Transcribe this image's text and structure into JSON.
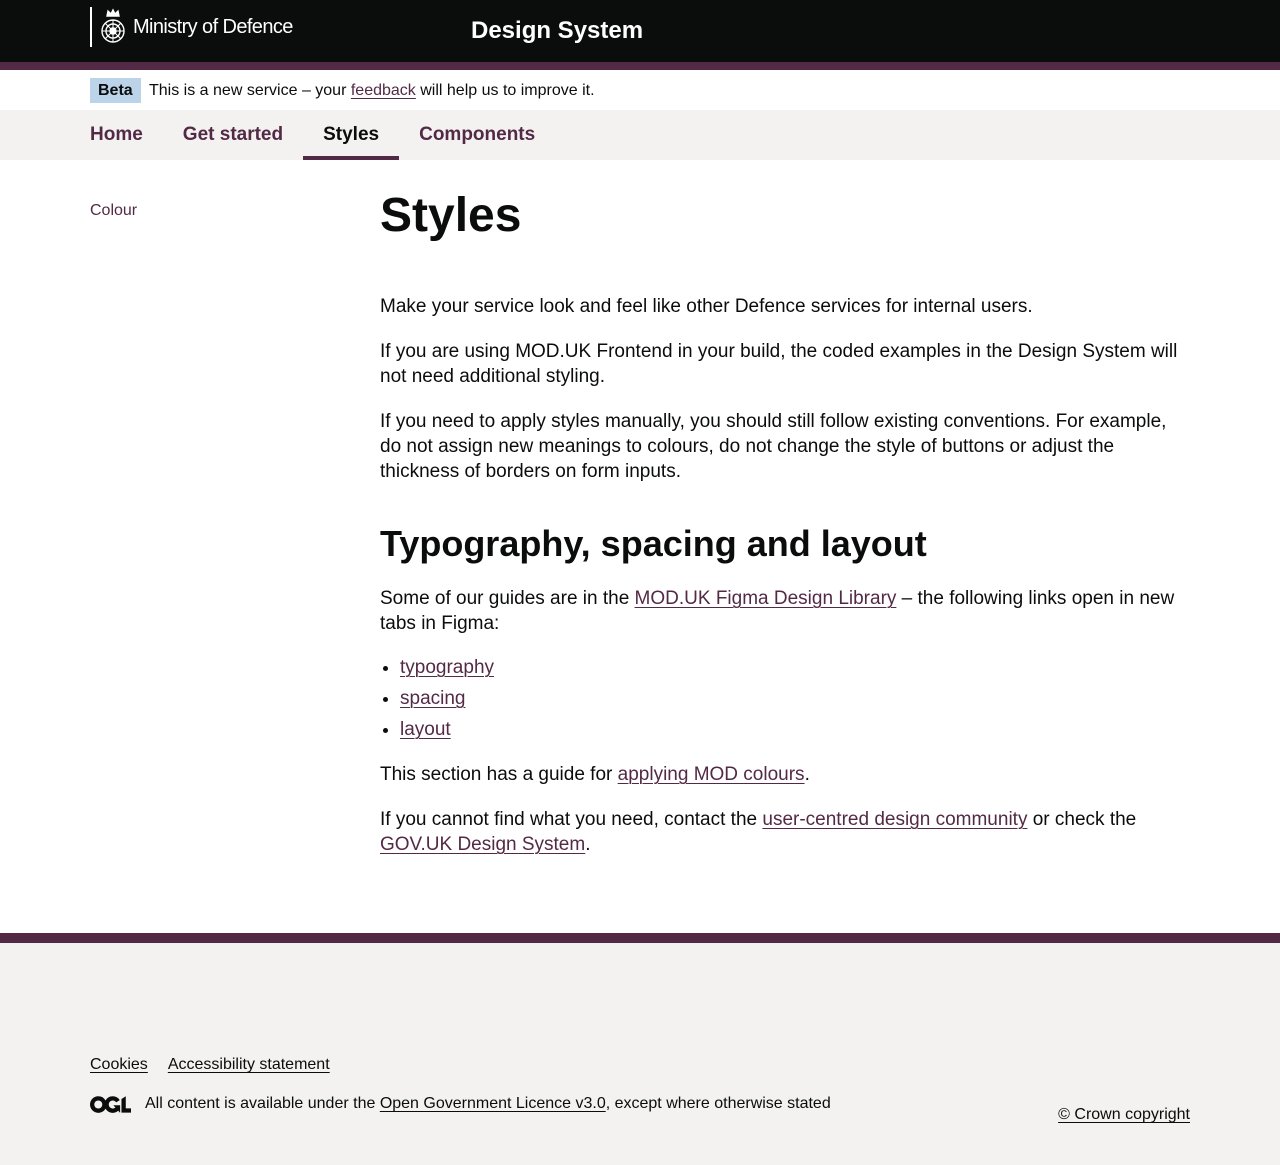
{
  "header": {
    "logo_text": "Ministry of Defence",
    "service_name": "Design System"
  },
  "phase_banner": {
    "tag": "Beta",
    "text_before": "This is a new service – your ",
    "link": "feedback",
    "text_after": " will help us to improve it."
  },
  "nav": {
    "items": [
      {
        "label": "Home"
      },
      {
        "label": "Get started"
      },
      {
        "label": "Styles",
        "active": true
      },
      {
        "label": "Components"
      }
    ]
  },
  "side_nav": {
    "items": [
      {
        "label": "Colour"
      }
    ]
  },
  "content": {
    "title": "Styles",
    "intro_1": "Make your service look and feel like other Defence services for internal users.",
    "intro_2": "If you are using MOD.UK Frontend in your build, the coded examples in the Design System will not need additional styling.",
    "intro_3": "If you need to apply styles manually, you should still follow existing conventions. For example, do not assign new meanings to colours, do not change the style of buttons or adjust the thickness of borders on form inputs.",
    "section_heading": "Typography, spacing and layout",
    "guides_before": "Some of our guides are in the ",
    "guides_link": "MOD.UK Figma Design Library",
    "guides_after": " – the following links open in new tabs in Figma:",
    "guide_links": [
      "typography",
      "spacing",
      "layout"
    ],
    "colour_before": "This section has a guide for ",
    "colour_link": "applying MOD colours",
    "colour_after": ".",
    "contact_before": "If you cannot find what you need, contact the ",
    "contact_link_1": "user-centred design community",
    "contact_middle": " or check the ",
    "contact_link_2": "GOV.UK Design System",
    "contact_after": "."
  },
  "footer": {
    "links": [
      "Cookies",
      "Accessibility statement"
    ],
    "licence_before": "All content is available under the ",
    "licence_link": "Open Government Licence v3.0",
    "licence_after": ", except where otherwise stated",
    "copyright": "© Crown copyright"
  },
  "colors": {
    "brand": "#532a45",
    "header_bg": "#0b0c0c",
    "tag_bg": "#bbd4ea",
    "panel_bg": "#f3f2f1"
  }
}
